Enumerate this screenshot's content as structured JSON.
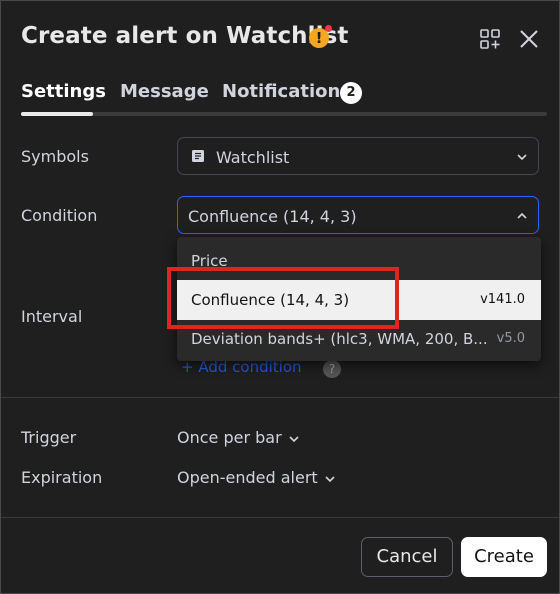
{
  "dialog": {
    "title": "Create alert on Watchlist",
    "warning_icon_glyph": "!"
  },
  "tabs": [
    {
      "label": "Settings",
      "active": true
    },
    {
      "label": "Message",
      "active": false
    },
    {
      "label": "Notifications",
      "active": false,
      "badge": "2"
    }
  ],
  "fields": {
    "symbols": {
      "label": "Symbols",
      "value": "Watchlist",
      "icon": "list-icon"
    },
    "condition": {
      "label": "Condition",
      "value": "Confluence (14, 4, 3)"
    },
    "interval": {
      "label": "Interval"
    },
    "trigger": {
      "label": "Trigger",
      "value": "Once per bar"
    },
    "expiration": {
      "label": "Expiration",
      "value": "Open-ended alert"
    }
  },
  "condition_dropdown": {
    "items": [
      {
        "name": "Price",
        "version": ""
      },
      {
        "name": "Confluence (14, 4, 3)",
        "version": "v141.0",
        "selected": true
      },
      {
        "name": "Deviation bands+ (hlc3, WMA, 200, B...",
        "version": "v5.0"
      }
    ]
  },
  "add_condition": {
    "label": "+ Add condition"
  },
  "buttons": {
    "cancel": "Cancel",
    "create": "Create"
  },
  "colors": {
    "accent": "#2962ff",
    "highlight": "#e02424",
    "warning": "#f5a623",
    "badge_dot": "#f23645"
  }
}
